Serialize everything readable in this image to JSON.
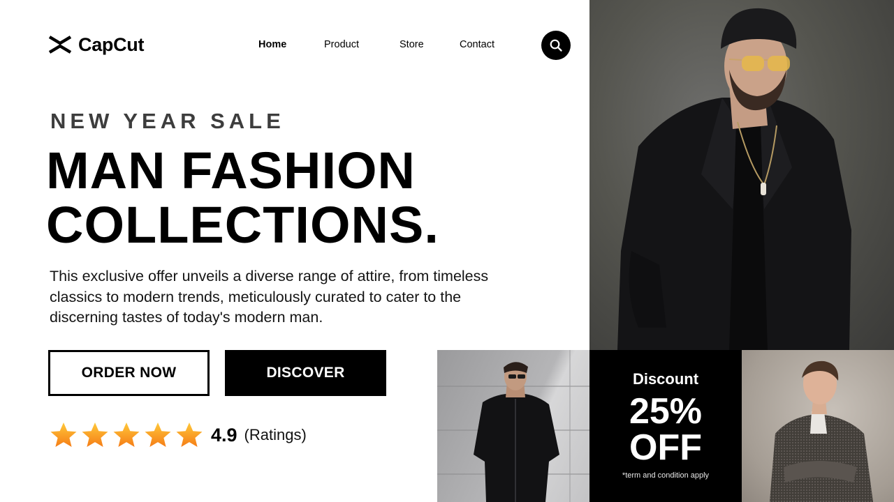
{
  "brand": {
    "name": "CapCut",
    "logo_icon": "capcut-logo-icon"
  },
  "nav": {
    "items": [
      {
        "label": "Home",
        "active": true
      },
      {
        "label": "Product",
        "active": false
      },
      {
        "label": "Store",
        "active": false
      },
      {
        "label": "Contact",
        "active": false
      }
    ],
    "search_icon": "search-icon"
  },
  "hero": {
    "eyebrow": "NEW YEAR SALE",
    "headline_line1": "MAN FASHION",
    "headline_line2": "COLLECTIONS.",
    "description": "This exclusive offer unveils a diverse range of attire, from timeless classics to modern trends, meticulously curated to cater to the discerning tastes of today's modern man."
  },
  "buttons": {
    "order_now": "ORDER NOW",
    "discover": "DISCOVER"
  },
  "rating": {
    "stars": 5,
    "value": "4.9",
    "label": "(Ratings)",
    "star_color": "#f7a01e"
  },
  "discount": {
    "title": "Discount",
    "value": "25%",
    "off": "OFF",
    "terms": "*term and condition apply"
  },
  "colors": {
    "primary": "#000000",
    "background": "#ffffff",
    "eyebrow": "#3d3d3d"
  }
}
